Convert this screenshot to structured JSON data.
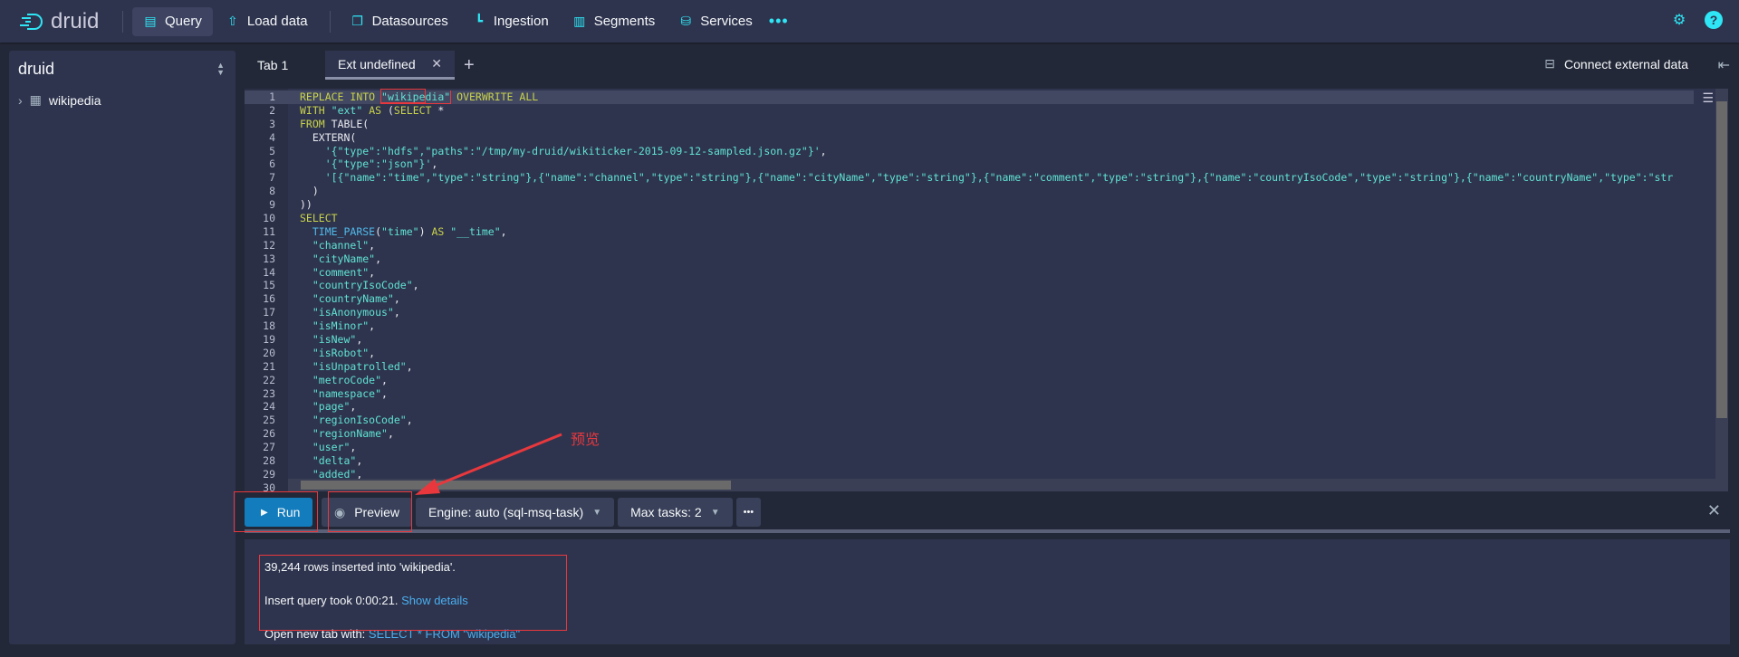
{
  "nav": {
    "logo": "druid",
    "items": [
      {
        "label": "Query",
        "icon": "query-icon",
        "active": true
      },
      {
        "label": "Load data",
        "icon": "upload-icon"
      },
      {
        "label": "Datasources",
        "icon": "datasources-icon"
      },
      {
        "label": "Ingestion",
        "icon": "ingestion-icon"
      },
      {
        "label": "Segments",
        "icon": "segments-icon"
      },
      {
        "label": "Services",
        "icon": "database-icon"
      }
    ],
    "more": "•••",
    "accent": "#2ee6f5"
  },
  "sidebar": {
    "title": "druid",
    "items": [
      {
        "label": "wikipedia"
      }
    ]
  },
  "tabs": [
    {
      "label": "Tab 1"
    },
    {
      "label": "Ext undefined",
      "active": true
    }
  ],
  "connect_label": "Connect external data",
  "editor": {
    "lines": [
      "REPLACE INTO \"wikipedia\" OVERWRITE ALL",
      "WITH \"ext\" AS (SELECT *",
      "FROM TABLE(",
      "  EXTERN(",
      "    '{\"type\":\"hdfs\",\"paths\":\"/tmp/my-druid/wikiticker-2015-09-12-sampled.json.gz\"}',",
      "    '{\"type\":\"json\"}',",
      "    '[{\"name\":\"time\",\"type\":\"string\"},{\"name\":\"channel\",\"type\":\"string\"},{\"name\":\"cityName\",\"type\":\"string\"},{\"name\":\"comment\",\"type\":\"string\"},{\"name\":\"countryIsoCode\",\"type\":\"string\"},{\"name\":\"countryName\",\"type\":\"str",
      "  )",
      "))",
      "SELECT",
      "  TIME_PARSE(\"time\") AS \"__time\",",
      "  \"channel\",",
      "  \"cityName\",",
      "  \"comment\",",
      "  \"countryIsoCode\",",
      "  \"countryName\",",
      "  \"isAnonymous\",",
      "  \"isMinor\",",
      "  \"isNew\",",
      "  \"isRobot\",",
      "  \"isUnpatrolled\",",
      "  \"metroCode\",",
      "  \"namespace\",",
      "  \"page\",",
      "  \"regionIsoCode\",",
      "  \"regionName\",",
      "  \"user\",",
      "  \"delta\",",
      "  \"added\",",
      ""
    ]
  },
  "toolbar": {
    "run": "Run",
    "preview": "Preview",
    "engine": "Engine: auto (sql-msq-task)",
    "max_tasks": "Max tasks: 2",
    "more": "•••"
  },
  "results": {
    "line1": "39,244 rows inserted into 'wikipedia'.",
    "line2_prefix": "Insert query took 0:00:21.",
    "line2_link": "Show details",
    "line3_prefix": "Open new tab with:",
    "line3_link": "SELECT * FROM \"wikipedia\""
  },
  "annotation": {
    "label": "预览",
    "color": "#e8383d"
  }
}
